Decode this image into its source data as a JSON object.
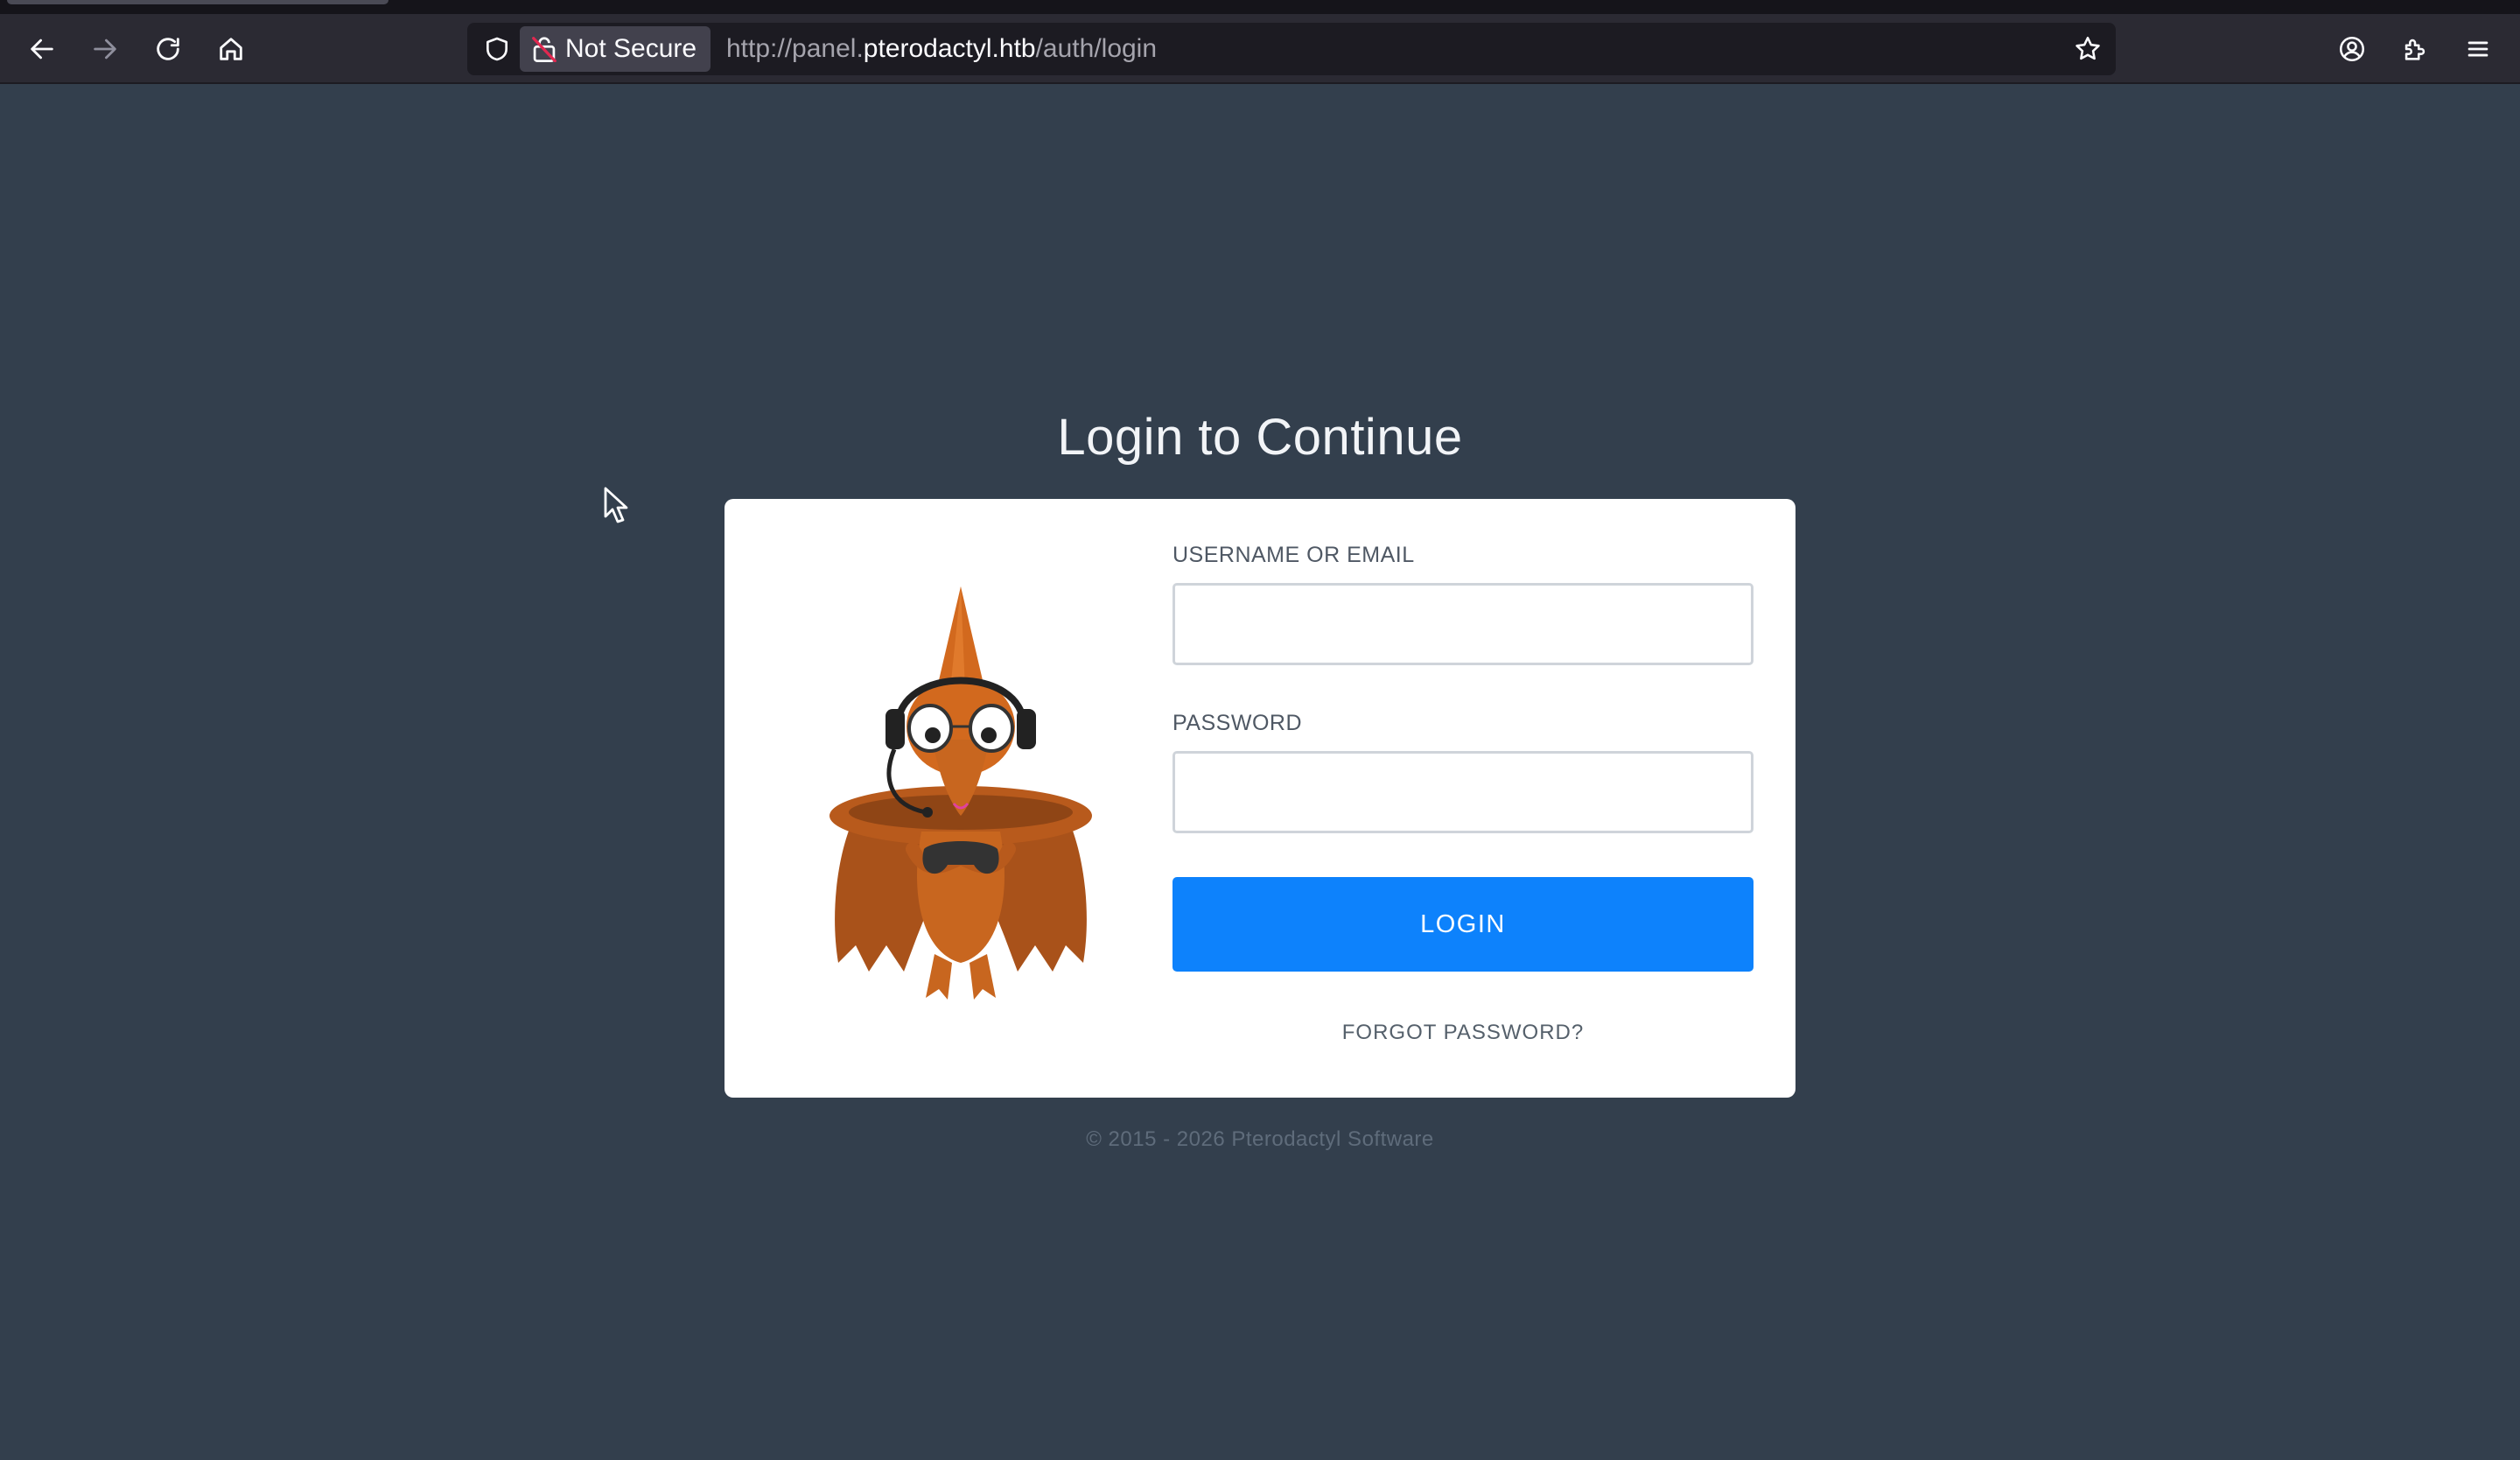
{
  "browser": {
    "security_label": "Not Secure",
    "url_prefix": "http://panel.",
    "url_host": "pterodactyl.htb",
    "url_path": "/auth/login",
    "icons": [
      "back-icon",
      "forward-icon",
      "reload-icon",
      "home-icon",
      "shield-icon",
      "insecure-lock-icon",
      "bookmark-star-icon",
      "account-icon",
      "extensions-icon",
      "menu-icon"
    ]
  },
  "page": {
    "title": "Login to Continue",
    "username_label": "USERNAME OR EMAIL",
    "username_value": "",
    "password_label": "PASSWORD",
    "password_value": "",
    "login_label": "LOGIN",
    "forgot_label": "FORGOT PASSWORD?",
    "footer": "© 2015 - 2026 Pterodactyl Software"
  },
  "colors": {
    "background": "#333f4d",
    "card": "#ffffff",
    "primary_button": "#0d82fc",
    "mascot": "#d2691e"
  }
}
